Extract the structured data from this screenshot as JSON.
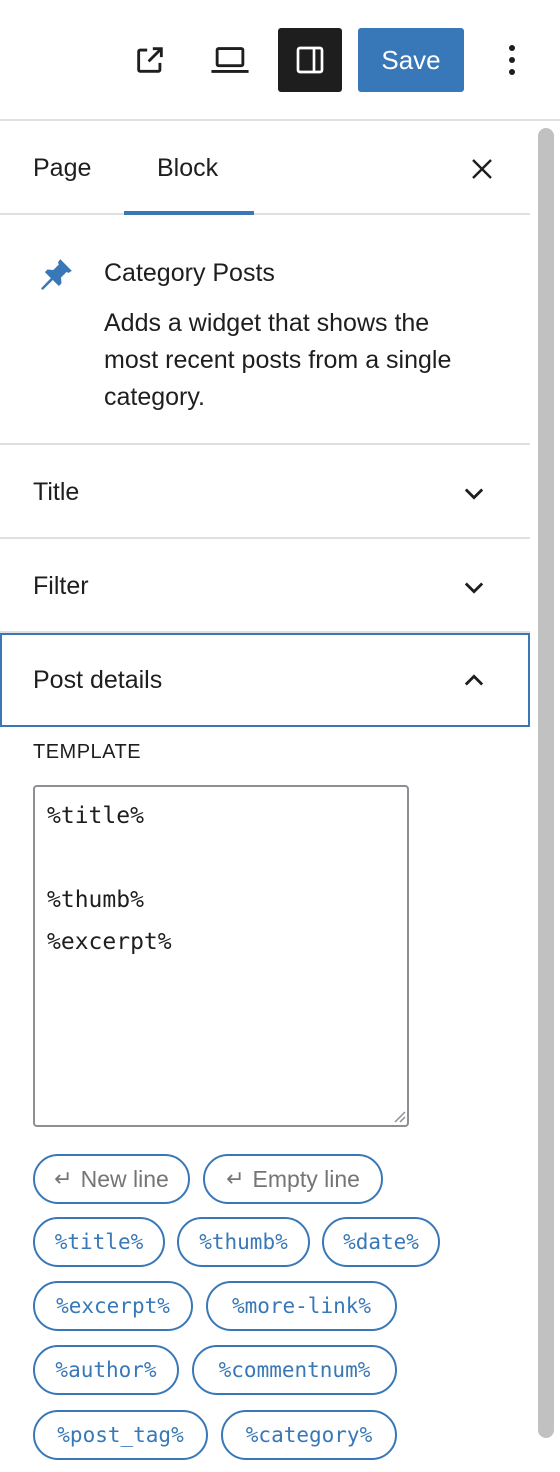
{
  "toolbar": {
    "view_icon": "external-link-icon",
    "device_icon": "laptop-icon",
    "sidebar_icon": "sidebar-toggle-icon",
    "save_label": "Save",
    "more_icon": "more-vertical-icon"
  },
  "tabs": {
    "page": "Page",
    "block": "Block",
    "close_icon": "close-icon"
  },
  "block": {
    "icon": "pin-icon",
    "name": "Category Posts",
    "description": "Adds a widget that shows the most recent posts from a single category."
  },
  "sections": {
    "title": "Title",
    "filter": "Filter",
    "post_details": "Post details"
  },
  "post_details": {
    "template_label": "TEMPLATE",
    "template_value": "%title%\n\n%thumb%\n%excerpt%",
    "buttons": {
      "new_line": "New line",
      "empty_line": "Empty line",
      "title": "%title%",
      "thumb": "%thumb%",
      "date": "%date%",
      "excerpt": "%excerpt%",
      "more_link": "%more-link%",
      "author": "%author%",
      "commentnum": "%commentnum%",
      "post_tag": "%post_tag%",
      "category": "%category%"
    },
    "return_glyph": "↵"
  },
  "colors": {
    "accent": "#3878b8",
    "text": "#1e1e1e",
    "border": "#e0e0e0"
  }
}
